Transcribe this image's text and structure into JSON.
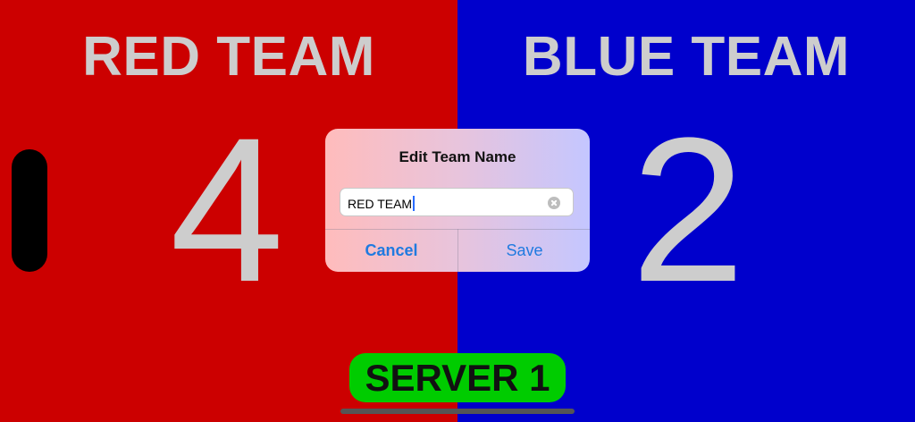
{
  "teams": {
    "red": {
      "name": "RED TEAM",
      "score": "4",
      "color": "#cc0000"
    },
    "blue": {
      "name": "BLUE TEAM",
      "score": "2",
      "color": "#0000cc"
    }
  },
  "server_badge": {
    "label": "SERVER 1",
    "color": "#00cc00"
  },
  "dialog": {
    "title": "Edit Team Name",
    "field_value": "RED TEAM",
    "clear_icon": "clear-circle-icon",
    "cancel_label": "Cancel",
    "save_label": "Save",
    "accent": "#1f7ae0"
  }
}
